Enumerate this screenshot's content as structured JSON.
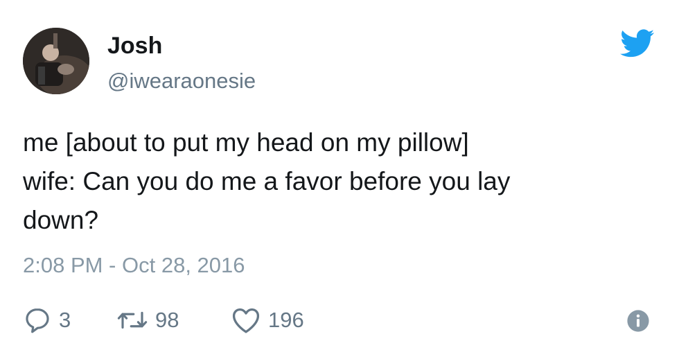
{
  "author": {
    "name": "Josh",
    "handle": "@iwearaonesie"
  },
  "tweet": {
    "lines": [
      "me [about to put my head on my pillow]",
      "wife: Can you do me a favor before you lay",
      "down?"
    ],
    "timestamp": "2:08 PM - Oct 28, 2016"
  },
  "stats": {
    "replies": "3",
    "retweets": "98",
    "likes": "196"
  },
  "icons": {
    "brand": "twitter-bird-icon",
    "reply": "reply-icon",
    "retweet": "retweet-icon",
    "like": "heart-icon",
    "info": "info-icon"
  },
  "colors": {
    "brand": "#1da1f2",
    "muted": "#657786",
    "timestamp": "#8899a6",
    "text": "#14171a"
  }
}
